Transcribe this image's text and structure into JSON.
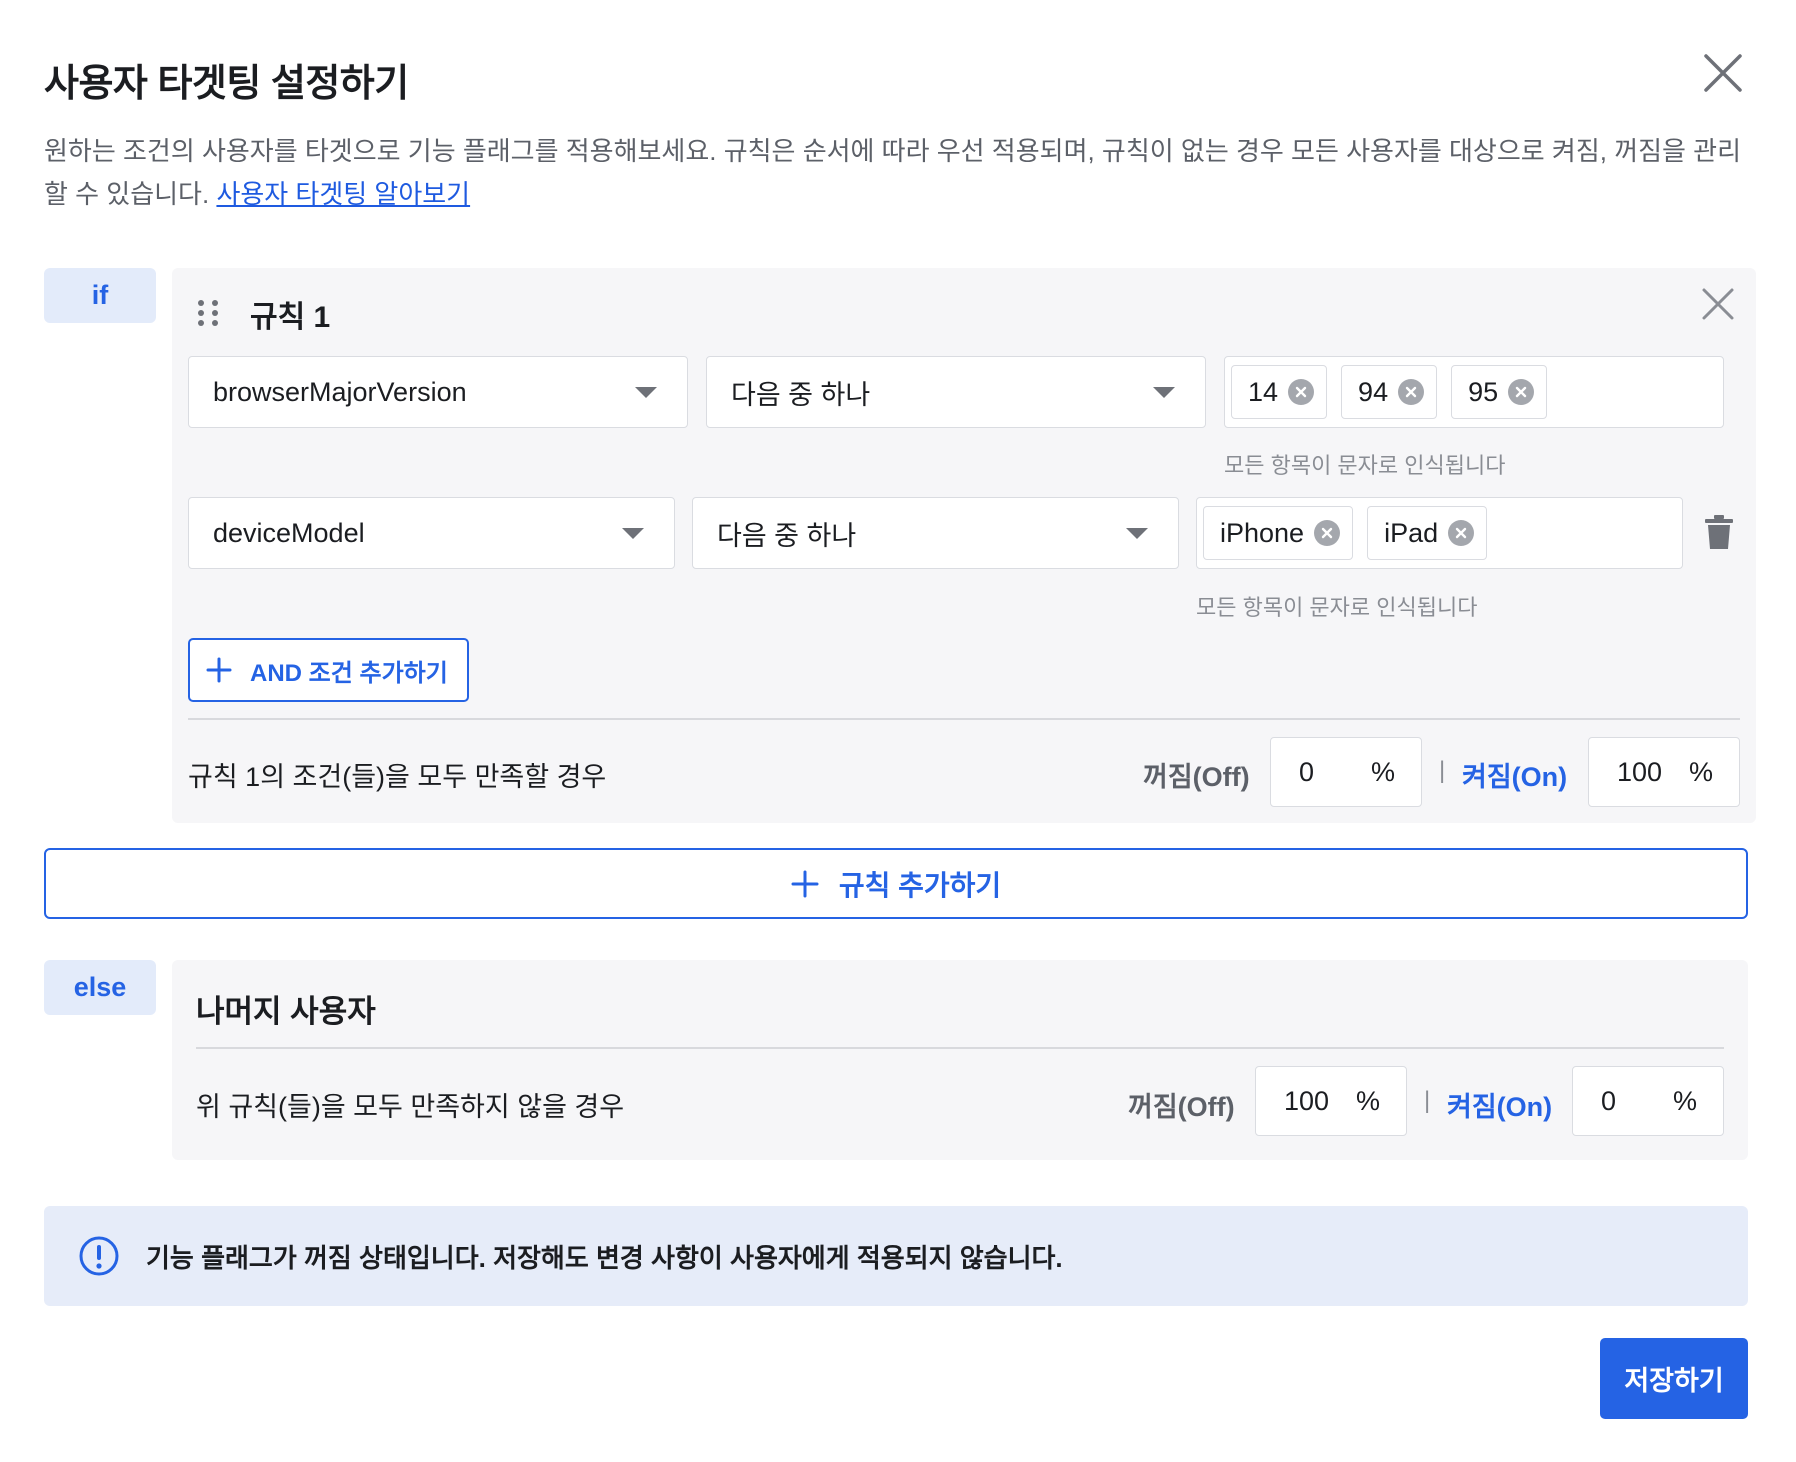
{
  "dialog": {
    "title": "사용자 타겟팅 설정하기",
    "description": "원하는 조건의 사용자를 타겟으로 기능 플래그를 적용해보세요. 규칙은 순서에 따라 우선 적용되며, 규칙이 없는 경우 모든 사용자를 대상으로 켜짐, 꺼짐을 관리할 수 있습니다.",
    "learn_more_link": "사용자 타겟팅 알아보기",
    "close_icon": "close-icon"
  },
  "if_block": {
    "tag": "if",
    "rule": {
      "title": "규칙 1",
      "conditions": [
        {
          "attribute": "browserMajorVersion",
          "operator": "다음 중 하나",
          "values": [
            "14",
            "94",
            "95"
          ],
          "hint": "모든 항목이 문자로 인식됩니다"
        },
        {
          "attribute": "deviceModel",
          "operator": "다음 중 하나",
          "values": [
            "iPhone",
            "iPad"
          ],
          "hint": "모든 항목이 문자로 인식됩니다"
        }
      ],
      "add_and_label": "AND 조건 추가하기",
      "footer_text": "규칙 1의 조건(들)을 모두 만족할 경우",
      "off_label": "꺼짐(Off)",
      "off_value": "0",
      "on_label": "켜짐(On)",
      "on_value": "100",
      "percent_sign": "%",
      "separator": "|"
    }
  },
  "add_rule_label": "규칙 추가하기",
  "else_block": {
    "tag": "else",
    "title": "나머지 사용자",
    "footer_text": "위 규칙(들)을 모두 만족하지 않을 경우",
    "off_label": "꺼짐(Off)",
    "off_value": "100",
    "on_label": "켜짐(On)",
    "on_value": "0",
    "percent_sign": "%",
    "separator": "|"
  },
  "banner": {
    "text": "기능 플래그가 꺼짐 상태입니다. 저장해도 변경 사항이 사용자에게 적용되지 않습니다.",
    "icon": "info-icon"
  },
  "save_label": "저장하기",
  "colors": {
    "accent": "#2563e4",
    "tag_bg": "#e3ebfa",
    "panel_bg": "#f6f6f8",
    "banner_bg": "#e6ecf9"
  }
}
